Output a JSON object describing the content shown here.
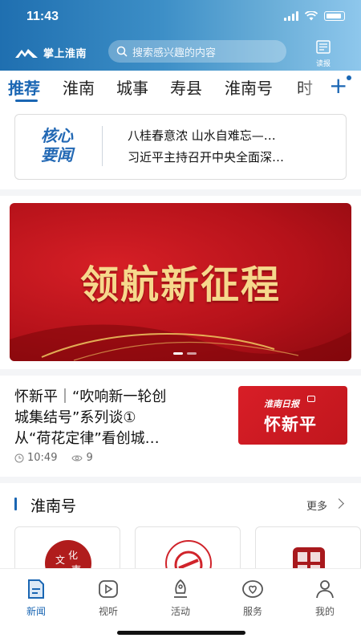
{
  "status": {
    "time": "11:43"
  },
  "header": {
    "app_name": "掌上淮南",
    "search_placeholder": "搜索感兴趣的内容",
    "paper_label": "读报"
  },
  "tabs": [
    {
      "label": "推荐",
      "active": true
    },
    {
      "label": "淮南"
    },
    {
      "label": "城事"
    },
    {
      "label": "寿县"
    },
    {
      "label": "淮南号"
    },
    {
      "label": "时"
    }
  ],
  "headlines": {
    "tag_line1": "核心",
    "tag_line2": "要闻",
    "items": [
      "八桂春意浓 山水自难忘—…",
      "习近平主持召开中央全面深…"
    ]
  },
  "banner": {
    "title": "领航新征程"
  },
  "news": {
    "title_lines": [
      "怀新平｜“吹响新一轮创",
      "城集结号”系列谈①",
      "从“荷花定律”看创城…"
    ],
    "time": "10:49",
    "views": "9",
    "thumb_top": "淮南日报",
    "thumb_main": "怀新平"
  },
  "section": {
    "title": "淮南号",
    "more": "更多"
  },
  "nav": [
    {
      "label": "新闻",
      "icon": "news-icon",
      "active": true
    },
    {
      "label": "视听",
      "icon": "play-icon"
    },
    {
      "label": "活动",
      "icon": "activity-icon"
    },
    {
      "label": "服务",
      "icon": "heart-icon"
    },
    {
      "label": "我的",
      "icon": "profile-icon"
    }
  ],
  "colors": {
    "accent": "#1a66b3",
    "banner_red": "#c0161d",
    "banner_gold": "#f6d88c"
  }
}
